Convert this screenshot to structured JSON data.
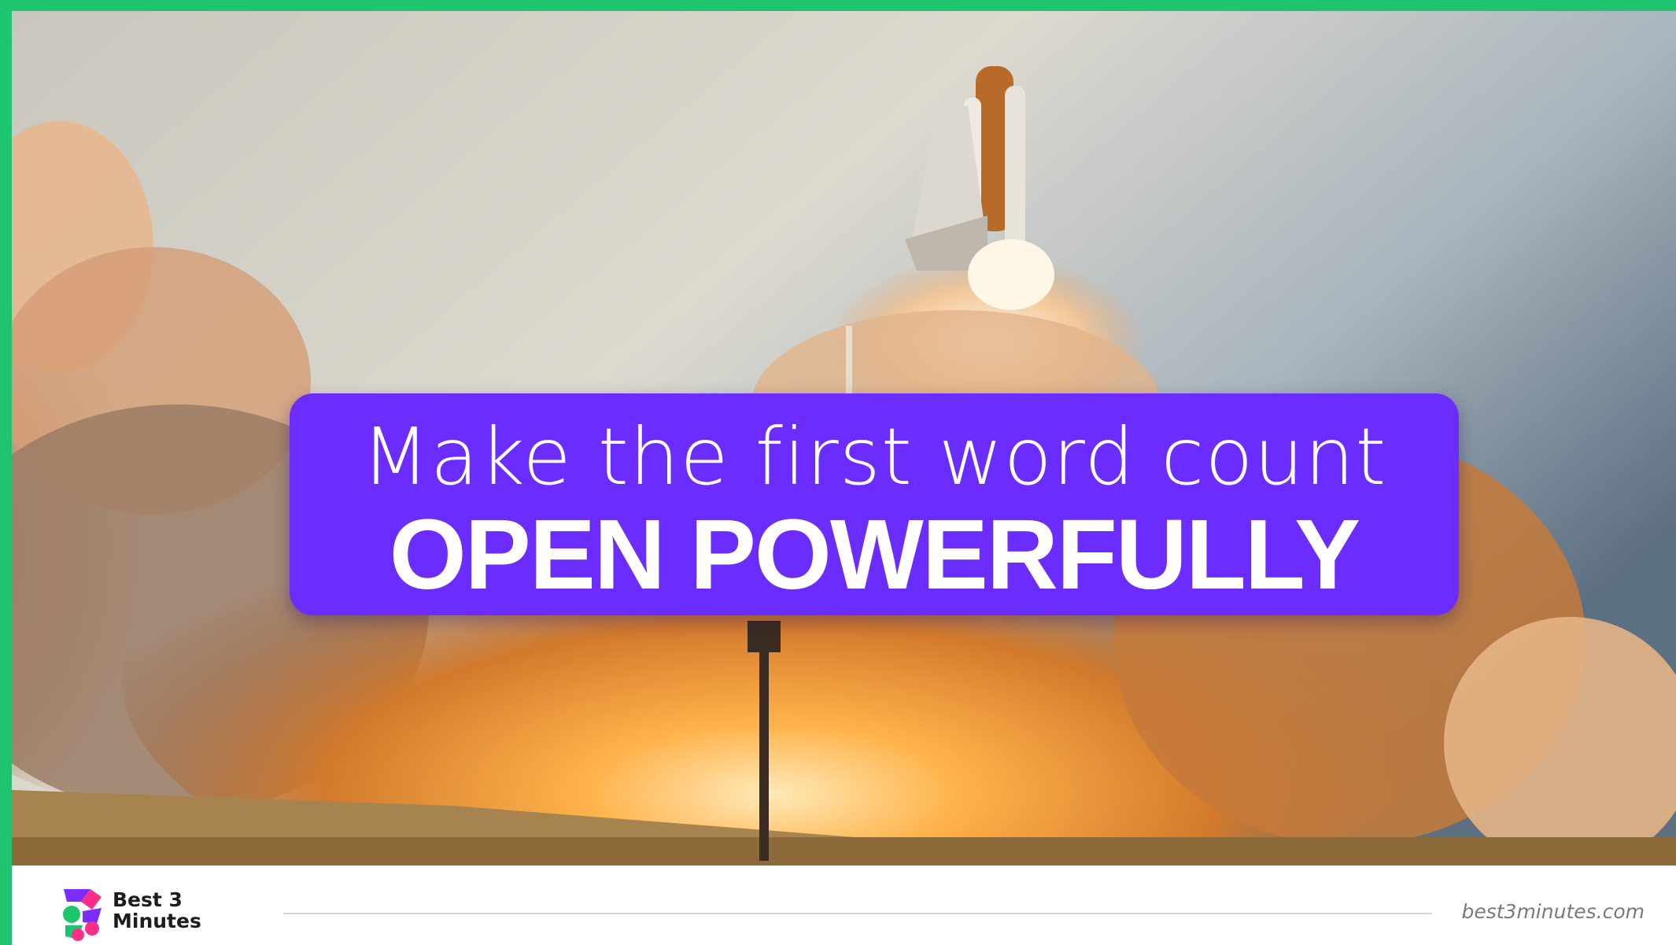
{
  "slide": {
    "subtitle": "Make the first word count",
    "title": "OPEN POWERFULLY",
    "background_image": "space-shuttle-launch",
    "accent_color": "#6a2cff",
    "frame_color": "#1fc46e"
  },
  "footer": {
    "logo_line1": "Best 3",
    "logo_line2": "Minutes",
    "website": "best3minutes.com",
    "logo_icon": "best3minutes-logo-icon"
  }
}
